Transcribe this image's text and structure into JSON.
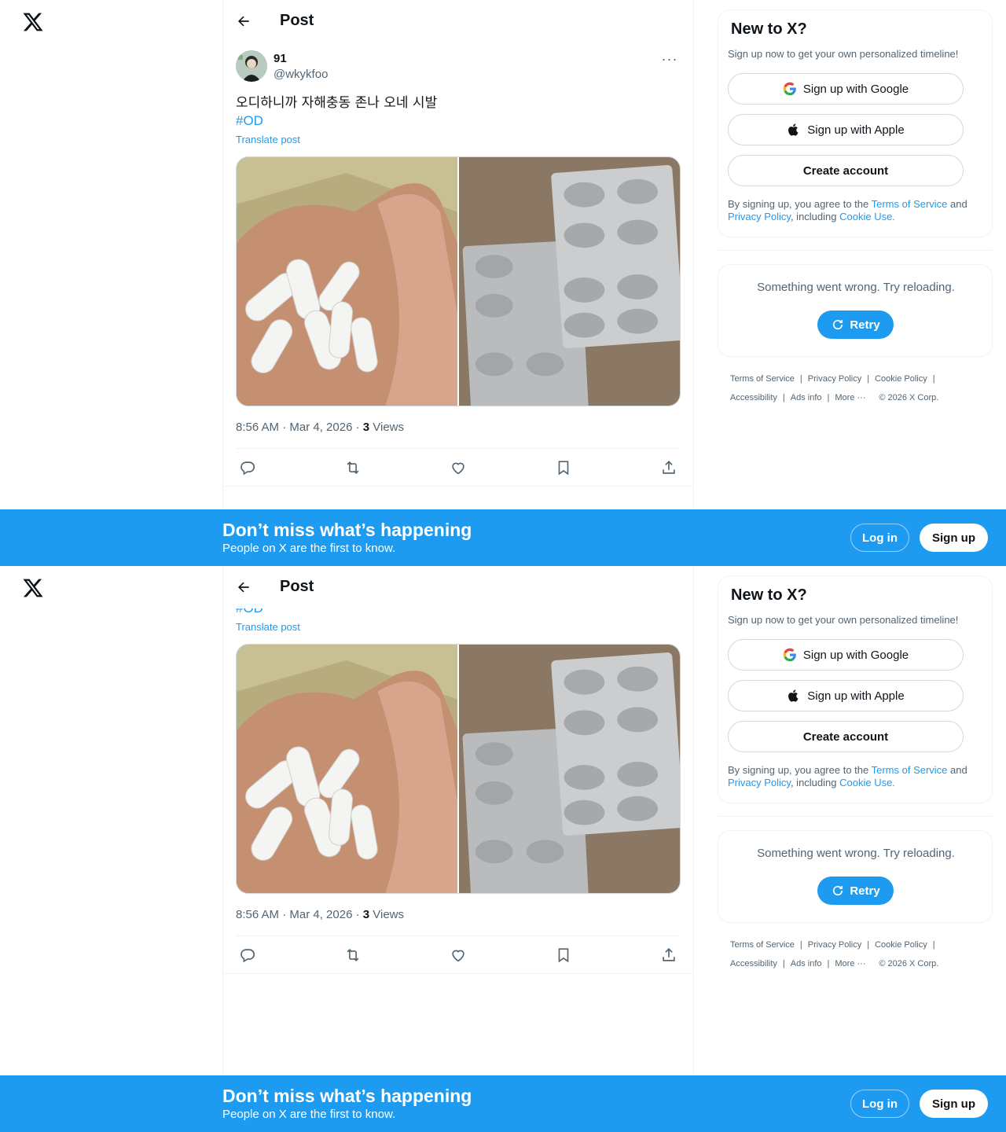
{
  "header": {
    "title": "Post"
  },
  "post": {
    "display_name": "91",
    "handle": "@wkykfoo",
    "text": "오디하니까 자해충동 존나 오네 시발",
    "hashtag": "#OD",
    "translate": "Translate post",
    "time": "8:56 AM · Mar 4, 2026 · ",
    "views_count": "3",
    "views_label": " Views",
    "more_glyph": "···"
  },
  "sidebar": {
    "title": "New to X?",
    "subtitle": "Sign up now to get your own personalized timeline!",
    "google_label": "Sign up with Google",
    "apple_label": "Sign up with Apple",
    "create_label": "Create account",
    "terms_1": "By signing up, you agree to the ",
    "terms_tos": "Terms of Service",
    "terms_2": " and ",
    "terms_privacy": "Privacy Policy",
    "terms_3": ", including ",
    "terms_cookie": "Cookie Use.",
    "error_text": "Something went wrong. Try reloading.",
    "retry_label": "Retry"
  },
  "footer": {
    "terms": "Terms of Service",
    "privacy": "Privacy Policy",
    "cookie": "Cookie Policy",
    "accessibility": "Accessibility",
    "ads": "Ads info",
    "more": "More ···",
    "copyright": "© 2026 X Corp."
  },
  "banner": {
    "title": "Don’t miss what’s happening",
    "subtitle": "People on X are the first to know.",
    "login": "Log in",
    "signup": "Sign up"
  },
  "icons": {
    "logo": "x-logo-icon",
    "back": "arrow-left-icon",
    "reply": "reply-icon",
    "repost": "repost-icon",
    "like": "heart-icon",
    "bookmark": "bookmark-icon",
    "share": "share-icon",
    "google": "google-icon",
    "apple": "apple-icon",
    "retry": "refresh-icon"
  },
  "colors": {
    "accent": "#1d9bf0",
    "text": "#0f1419",
    "muted": "#536471"
  }
}
